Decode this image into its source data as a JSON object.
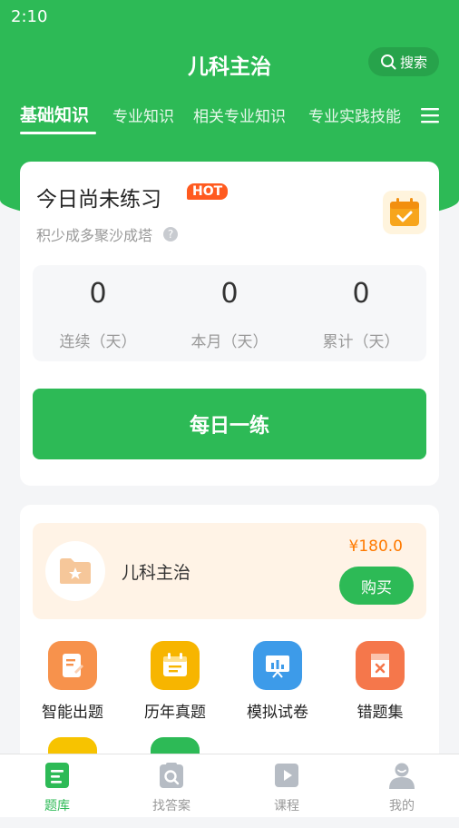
{
  "status_bar": {
    "time": "2:10"
  },
  "header": {
    "title": "儿科主治",
    "search_label": "搜索"
  },
  "tabs": [
    {
      "label": "基础知识",
      "active": true
    },
    {
      "label": "专业知识",
      "active": false
    },
    {
      "label": "相关专业知识",
      "active": false
    },
    {
      "label": "专业实践技能",
      "active": false
    }
  ],
  "practice_card": {
    "title": "今日尚未练习",
    "badge": "HOT",
    "subtitle": "积少成多聚沙成塔",
    "stats": [
      {
        "value": "0",
        "label": "连续（天）"
      },
      {
        "value": "0",
        "label": "本月（天）"
      },
      {
        "value": "0",
        "label": "累计（天）"
      }
    ],
    "button_label": "每日一练"
  },
  "product": {
    "name": "儿科主治",
    "price": "¥180.0",
    "buy_label": "购买"
  },
  "features": [
    {
      "label": "智能出题",
      "icon": "smart-question-icon",
      "color": "#f7924c"
    },
    {
      "label": "历年真题",
      "icon": "past-exams-icon",
      "color": "#f7b500"
    },
    {
      "label": "模拟试卷",
      "icon": "mock-exam-icon",
      "color": "#3d9be9"
    },
    {
      "label": "错题集",
      "icon": "wrong-questions-icon",
      "color": "#f5774b"
    }
  ],
  "bottom_nav": [
    {
      "label": "题库",
      "icon": "question-bank-icon",
      "active": true
    },
    {
      "label": "找答案",
      "icon": "find-answer-icon",
      "active": false
    },
    {
      "label": "课程",
      "icon": "course-icon",
      "active": false
    },
    {
      "label": "我的",
      "icon": "profile-icon",
      "active": false
    }
  ],
  "colors": {
    "primary": "#2dba56",
    "hot": "#ff5a1f",
    "price": "#ff7a00"
  }
}
